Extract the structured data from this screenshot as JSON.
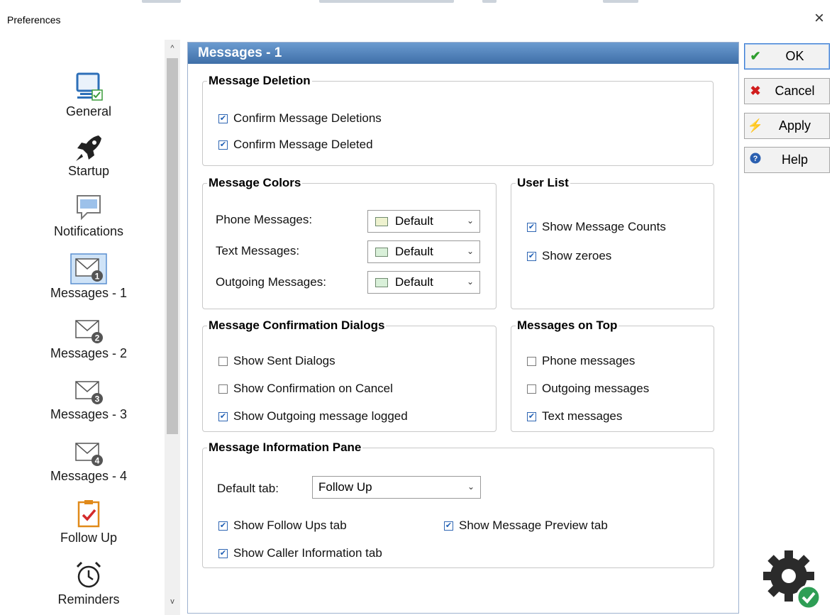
{
  "window": {
    "title": "Preferences",
    "close_glyph": "×"
  },
  "nav": {
    "items": [
      {
        "label": "General",
        "icon": "monitor-icon"
      },
      {
        "label": "Startup",
        "icon": "rocket-icon"
      },
      {
        "label": "Notifications",
        "icon": "speech-bubble-icon"
      },
      {
        "label": "Messages - 1",
        "icon": "envelope-1-icon",
        "selected": true
      },
      {
        "label": "Messages - 2",
        "icon": "envelope-2-icon"
      },
      {
        "label": "Messages - 3",
        "icon": "envelope-3-icon"
      },
      {
        "label": "Messages - 4",
        "icon": "envelope-4-icon"
      },
      {
        "label": "Follow Up",
        "icon": "clipboard-check-icon"
      },
      {
        "label": "Reminders",
        "icon": "alarm-clock-icon"
      }
    ],
    "scroll_up": "^",
    "scroll_down": "v"
  },
  "panel": {
    "title": "Messages - 1",
    "message_deletion": {
      "legend": "Message Deletion",
      "confirm_deletions": {
        "label": "Confirm Message Deletions",
        "checked": true
      },
      "confirm_deleted": {
        "label": "Confirm Message Deleted",
        "checked": true
      }
    },
    "message_colors": {
      "legend": "Message Colors",
      "phone": {
        "label": "Phone Messages:",
        "value": "Default",
        "swatch": "#eef2cf"
      },
      "text": {
        "label": "Text Messages:",
        "value": "Default",
        "swatch": "#d9f0d9"
      },
      "outgoing": {
        "label": "Outgoing Messages:",
        "value": "Default",
        "swatch": "#d9f0d9"
      }
    },
    "user_list": {
      "legend": "User List",
      "show_counts": {
        "label": "Show Message Counts",
        "checked": true
      },
      "show_zeroes": {
        "label": "Show zeroes",
        "checked": true
      }
    },
    "confirmation_dialogs": {
      "legend": "Message Confirmation Dialogs",
      "show_sent": {
        "label": "Show Sent Dialogs",
        "checked": false
      },
      "show_cancel": {
        "label": "Show Confirmation on Cancel",
        "checked": false
      },
      "show_logged": {
        "label": "Show Outgoing message logged",
        "checked": true
      }
    },
    "messages_on_top": {
      "legend": "Messages on Top",
      "phone": {
        "label": "Phone messages",
        "checked": false
      },
      "outgoing": {
        "label": "Outgoing messages",
        "checked": false
      },
      "text": {
        "label": "Text messages",
        "checked": true
      }
    },
    "info_pane": {
      "legend": "Message Information Pane",
      "default_tab_label": "Default tab:",
      "default_tab_value": "Follow Up",
      "show_followups": {
        "label": "Show Follow Ups tab",
        "checked": true
      },
      "show_preview": {
        "label": "Show Message Preview tab",
        "checked": true
      },
      "show_caller": {
        "label": "Show Caller Information tab",
        "checked": true
      }
    }
  },
  "buttons": {
    "ok": {
      "label": "OK",
      "icon": "checkmark-icon",
      "icon_glyph": "✔",
      "color": "#2e9e2e"
    },
    "cancel": {
      "label": "Cancel",
      "icon": "x-icon",
      "icon_glyph": "✖",
      "color": "#d01c1c"
    },
    "apply": {
      "label": "Apply",
      "icon": "lightning-icon",
      "icon_glyph": "⚡",
      "color": "#e8b400"
    },
    "help": {
      "label": "Help",
      "icon": "help-icon",
      "icon_glyph": "?",
      "color": "#2a5fb0"
    }
  },
  "colors": {
    "panel_header": "#4a7db8",
    "selected_nav": "#cfe3f7",
    "check": "#1f5fb5"
  },
  "check_glyph": "✔"
}
